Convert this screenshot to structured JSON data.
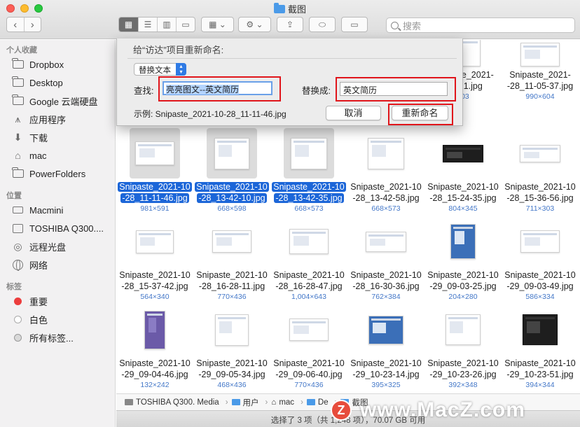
{
  "window": {
    "title": "截图"
  },
  "toolbar": {
    "search_placeholder": "搜索",
    "view_icons_glyph": "▦",
    "view_list_glyph": "☰",
    "view_column_glyph": "▥",
    "view_gallery_glyph": "▭",
    "group_glyph": "▦ ⌄",
    "action_glyph": "⚙ ⌄",
    "share_glyph": "⇪",
    "tag_glyph": "⬭",
    "newfolder_glyph": "▭"
  },
  "sidebar": {
    "favorites_title": "个人收藏",
    "favorites": [
      {
        "label": "Dropbox",
        "icon": "folder-icon"
      },
      {
        "label": "Desktop",
        "icon": "folder-icon"
      },
      {
        "label": "Google 云端硬盘",
        "icon": "folder-icon"
      },
      {
        "label": "应用程序",
        "icon": "applications-icon"
      },
      {
        "label": "下载",
        "icon": "download-icon"
      },
      {
        "label": "mac",
        "icon": "home-icon"
      },
      {
        "label": "PowerFolders",
        "icon": "folder-icon"
      }
    ],
    "locations_title": "位置",
    "locations": [
      {
        "label": "Macmini",
        "icon": "computer-icon"
      },
      {
        "label": "TOSHIBA Q300....",
        "icon": "disk-icon"
      },
      {
        "label": "远程光盘",
        "icon": "disc-icon"
      },
      {
        "label": "网络",
        "icon": "network-icon"
      }
    ],
    "tags_title": "标签",
    "tags": [
      {
        "label": "重要",
        "color": "#ec3d3d"
      },
      {
        "label": "白色",
        "color": "#ffffff"
      },
      {
        "label": "所有标签...",
        "icon": "all-tags-icon"
      }
    ]
  },
  "dialog": {
    "title": "给“访达”项目重新命名:",
    "mode": "替换文本",
    "find_label": "查找:",
    "find_value": "亮亮图文--英文简历",
    "replace_label": "替换成:",
    "replace_value": "英文简历",
    "example": "示例: Snipaste_2021-10-28_11-11-46.jpg",
    "cancel": "取消",
    "rename": "重新命名"
  },
  "files": [
    {
      "line1": "Snipaste_2021-",
      "line2": "...5-21.jpg",
      "dim": "603",
      "partial": true
    },
    {
      "line1": "Snipaste_2021-",
      "line2": "-28_11-05-37.jpg",
      "dim": "990×604",
      "partial": true
    },
    {
      "line1": "Snipaste_2021-10",
      "line2": "-28_11-11-46.jpg",
      "dim": "981×591",
      "selected": true
    },
    {
      "line1": "Snipaste_2021-10",
      "line2": "-28_13-42-10.jpg",
      "dim": "668×598",
      "selected": true
    },
    {
      "line1": "Snipaste_2021-10",
      "line2": "-28_13-42-35.jpg",
      "dim": "668×573",
      "selected": true
    },
    {
      "line1": "Snipaste_2021-10",
      "line2": "-28_13-42-58.jpg",
      "dim": "668×573"
    },
    {
      "line1": "Snipaste_2021-10",
      "line2": "-28_15-24-35.jpg",
      "dim": "804×345",
      "style": "dark"
    },
    {
      "line1": "Snipaste_2021-10",
      "line2": "-28_15-36-56.jpg",
      "dim": "711×303"
    },
    {
      "line1": "Snipaste_2021-10",
      "line2": "-28_15-37-42.jpg",
      "dim": "564×340"
    },
    {
      "line1": "Snipaste_2021-10",
      "line2": "-28_16-28-11.jpg",
      "dim": "770×436"
    },
    {
      "line1": "Snipaste_2021-10",
      "line2": "-28_16-28-47.jpg",
      "dim": "1,004×643"
    },
    {
      "line1": "Snipaste_2021-10",
      "line2": "-28_16-30-36.jpg",
      "dim": "762×384"
    },
    {
      "line1": "Snipaste_2021-10",
      "line2": "-29_09-03-25.jpg",
      "dim": "204×280",
      "style": "phone"
    },
    {
      "line1": "Snipaste_2021-10",
      "line2": "-29_09-03-49.jpg",
      "dim": "586×334"
    },
    {
      "line1": "Snipaste_2021-10",
      "line2": "-29_09-04-46.jpg",
      "dim": "132×242",
      "style": "purple"
    },
    {
      "line1": "Snipaste_2021-10",
      "line2": "-29_09-05-34.jpg",
      "dim": "468×436"
    },
    {
      "line1": "Snipaste_2021-10",
      "line2": "-29_09-06-40.jpg",
      "dim": "770×436"
    },
    {
      "line1": "Snipaste_2021-10",
      "line2": "-29_10-23-14.jpg",
      "dim": "395×325",
      "style": "phone"
    },
    {
      "line1": "Snipaste_2021-10",
      "line2": "-29_10-23-26.jpg",
      "dim": "392×348"
    },
    {
      "line1": "Snipaste_2021-10",
      "line2": "-29_10-23-51.jpg",
      "dim": "394×344",
      "style": "dark"
    }
  ],
  "pathbar": [
    "TOSHIBA Q300. Media",
    "用户",
    "mac",
    "De",
    "截图"
  ],
  "status": "选择了 3 项（共 1,248 项），70.07 GB 可用",
  "watermark": "www.MacZ.com",
  "watermark_logo": "Z"
}
